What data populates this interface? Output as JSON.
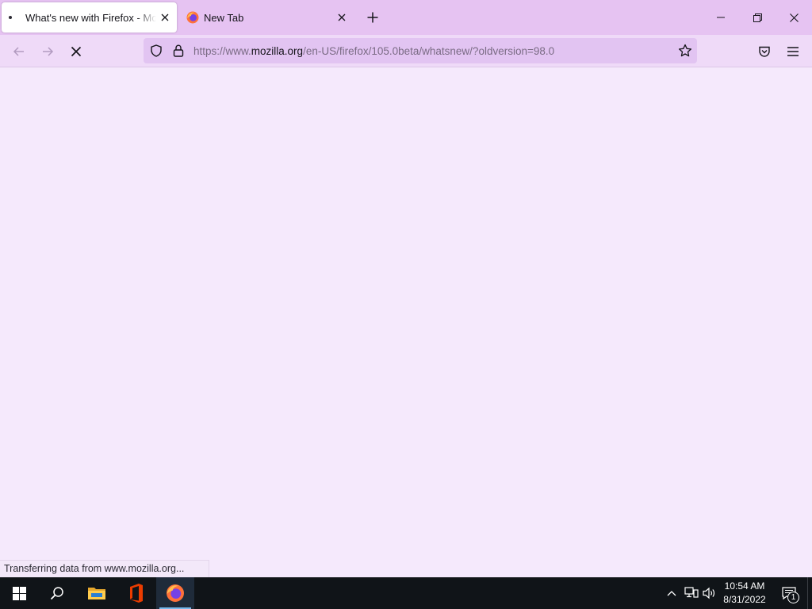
{
  "browser": {
    "tabs": [
      {
        "title": "What's new with Firefox - More",
        "active": true,
        "loading": true
      },
      {
        "title": "New Tab",
        "active": false
      }
    ],
    "url": {
      "prefix": "https://www.",
      "domain": "mozilla.org",
      "path": "/en-US/firefox/105.0beta/whatsnew/?oldversion=98.0"
    },
    "status_text": "Transferring data from www.mozilla.org...",
    "icons": {
      "back": "back-arrow-icon",
      "forward": "forward-arrow-icon",
      "stop": "stop-icon",
      "shield": "tracking-protection-shield-icon",
      "lock": "lock-icon",
      "star": "bookmark-star-icon",
      "pocket": "pocket-icon",
      "menu": "hamburger-menu-icon"
    },
    "colors": {
      "tabstrip": "#e6c3f2",
      "navbar": "#efdaf8",
      "urlbar": "#e2c4f2",
      "content": "#f5e9fc"
    }
  },
  "taskbar": {
    "clock_time": "10:54 AM",
    "clock_date": "8/31/2022",
    "notification_count": "1",
    "pinned_apps": [
      "start-icon",
      "search-icon",
      "file-explorer-icon",
      "office-icon",
      "firefox-icon"
    ]
  }
}
